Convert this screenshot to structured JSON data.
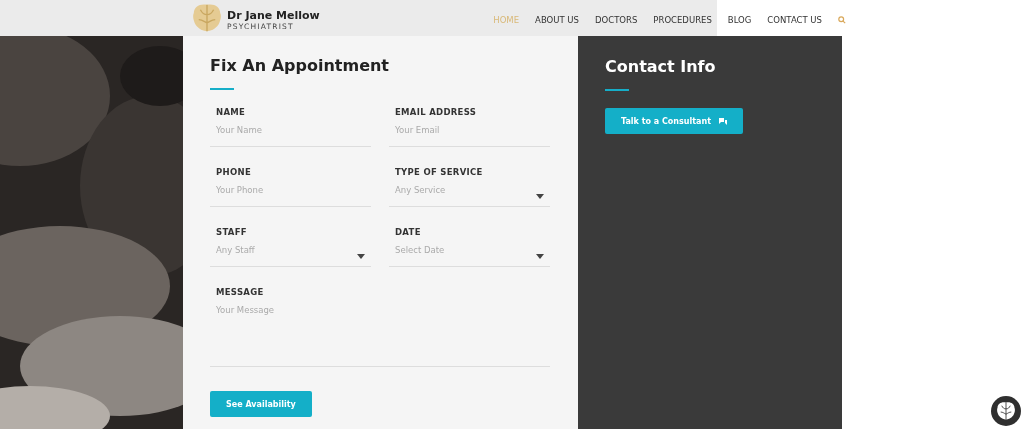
{
  "brand": {
    "name": "Dr Jane Mellow",
    "tagline": "PSYCHIATRIST"
  },
  "nav": [
    {
      "label": "HOME",
      "selected": true
    },
    {
      "label": "ABOUT US",
      "selected": false
    },
    {
      "label": "DOCTORS",
      "selected": false
    },
    {
      "label": "PROCEDURES",
      "selected": false
    },
    {
      "label": "BLOG",
      "selected": false
    },
    {
      "label": "CONTACT US",
      "selected": false
    }
  ],
  "form": {
    "title": "Fix An Appointment",
    "fields": [
      {
        "kind": "input",
        "label": "NAME",
        "placeholder": "Your Name"
      },
      {
        "kind": "input",
        "label": "EMAIL ADDRESS",
        "placeholder": "Your Email"
      },
      {
        "kind": "input",
        "label": "PHONE",
        "placeholder": "Your Phone"
      },
      {
        "kind": "select",
        "label": "TYPE OF SERVICE",
        "placeholder": "Any Service"
      },
      {
        "kind": "select",
        "label": "STAFF",
        "placeholder": "Any Staff"
      },
      {
        "kind": "select",
        "label": "DATE",
        "placeholder": "Select Date"
      },
      {
        "kind": "textarea",
        "label": "MESSAGE",
        "placeholder": "Your Message"
      }
    ],
    "submit": "See Availability"
  },
  "contact": {
    "title": "Contact Info",
    "button": "Talk to a Consultant"
  }
}
